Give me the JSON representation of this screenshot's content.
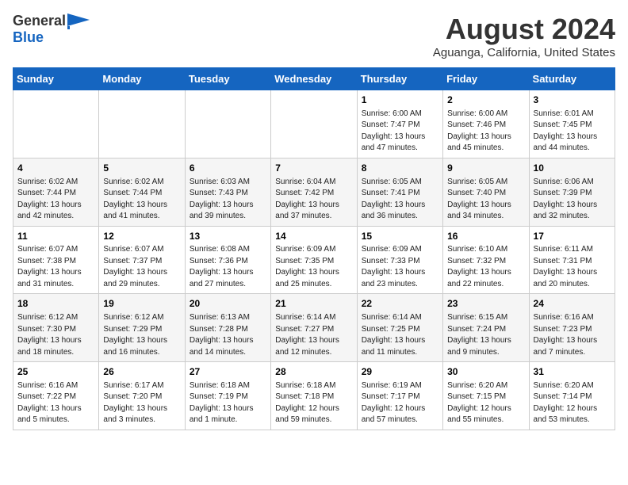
{
  "header": {
    "logo_general": "General",
    "logo_blue": "Blue",
    "month": "August 2024",
    "location": "Aguanga, California, United States"
  },
  "weekdays": [
    "Sunday",
    "Monday",
    "Tuesday",
    "Wednesday",
    "Thursday",
    "Friday",
    "Saturday"
  ],
  "weeks": [
    [
      {
        "day": "",
        "info": ""
      },
      {
        "day": "",
        "info": ""
      },
      {
        "day": "",
        "info": ""
      },
      {
        "day": "",
        "info": ""
      },
      {
        "day": "1",
        "info": "Sunrise: 6:00 AM\nSunset: 7:47 PM\nDaylight: 13 hours\nand 47 minutes."
      },
      {
        "day": "2",
        "info": "Sunrise: 6:00 AM\nSunset: 7:46 PM\nDaylight: 13 hours\nand 45 minutes."
      },
      {
        "day": "3",
        "info": "Sunrise: 6:01 AM\nSunset: 7:45 PM\nDaylight: 13 hours\nand 44 minutes."
      }
    ],
    [
      {
        "day": "4",
        "info": "Sunrise: 6:02 AM\nSunset: 7:44 PM\nDaylight: 13 hours\nand 42 minutes."
      },
      {
        "day": "5",
        "info": "Sunrise: 6:02 AM\nSunset: 7:44 PM\nDaylight: 13 hours\nand 41 minutes."
      },
      {
        "day": "6",
        "info": "Sunrise: 6:03 AM\nSunset: 7:43 PM\nDaylight: 13 hours\nand 39 minutes."
      },
      {
        "day": "7",
        "info": "Sunrise: 6:04 AM\nSunset: 7:42 PM\nDaylight: 13 hours\nand 37 minutes."
      },
      {
        "day": "8",
        "info": "Sunrise: 6:05 AM\nSunset: 7:41 PM\nDaylight: 13 hours\nand 36 minutes."
      },
      {
        "day": "9",
        "info": "Sunrise: 6:05 AM\nSunset: 7:40 PM\nDaylight: 13 hours\nand 34 minutes."
      },
      {
        "day": "10",
        "info": "Sunrise: 6:06 AM\nSunset: 7:39 PM\nDaylight: 13 hours\nand 32 minutes."
      }
    ],
    [
      {
        "day": "11",
        "info": "Sunrise: 6:07 AM\nSunset: 7:38 PM\nDaylight: 13 hours\nand 31 minutes."
      },
      {
        "day": "12",
        "info": "Sunrise: 6:07 AM\nSunset: 7:37 PM\nDaylight: 13 hours\nand 29 minutes."
      },
      {
        "day": "13",
        "info": "Sunrise: 6:08 AM\nSunset: 7:36 PM\nDaylight: 13 hours\nand 27 minutes."
      },
      {
        "day": "14",
        "info": "Sunrise: 6:09 AM\nSunset: 7:35 PM\nDaylight: 13 hours\nand 25 minutes."
      },
      {
        "day": "15",
        "info": "Sunrise: 6:09 AM\nSunset: 7:33 PM\nDaylight: 13 hours\nand 23 minutes."
      },
      {
        "day": "16",
        "info": "Sunrise: 6:10 AM\nSunset: 7:32 PM\nDaylight: 13 hours\nand 22 minutes."
      },
      {
        "day": "17",
        "info": "Sunrise: 6:11 AM\nSunset: 7:31 PM\nDaylight: 13 hours\nand 20 minutes."
      }
    ],
    [
      {
        "day": "18",
        "info": "Sunrise: 6:12 AM\nSunset: 7:30 PM\nDaylight: 13 hours\nand 18 minutes."
      },
      {
        "day": "19",
        "info": "Sunrise: 6:12 AM\nSunset: 7:29 PM\nDaylight: 13 hours\nand 16 minutes."
      },
      {
        "day": "20",
        "info": "Sunrise: 6:13 AM\nSunset: 7:28 PM\nDaylight: 13 hours\nand 14 minutes."
      },
      {
        "day": "21",
        "info": "Sunrise: 6:14 AM\nSunset: 7:27 PM\nDaylight: 13 hours\nand 12 minutes."
      },
      {
        "day": "22",
        "info": "Sunrise: 6:14 AM\nSunset: 7:25 PM\nDaylight: 13 hours\nand 11 minutes."
      },
      {
        "day": "23",
        "info": "Sunrise: 6:15 AM\nSunset: 7:24 PM\nDaylight: 13 hours\nand 9 minutes."
      },
      {
        "day": "24",
        "info": "Sunrise: 6:16 AM\nSunset: 7:23 PM\nDaylight: 13 hours\nand 7 minutes."
      }
    ],
    [
      {
        "day": "25",
        "info": "Sunrise: 6:16 AM\nSunset: 7:22 PM\nDaylight: 13 hours\nand 5 minutes."
      },
      {
        "day": "26",
        "info": "Sunrise: 6:17 AM\nSunset: 7:20 PM\nDaylight: 13 hours\nand 3 minutes."
      },
      {
        "day": "27",
        "info": "Sunrise: 6:18 AM\nSunset: 7:19 PM\nDaylight: 13 hours\nand 1 minute."
      },
      {
        "day": "28",
        "info": "Sunrise: 6:18 AM\nSunset: 7:18 PM\nDaylight: 12 hours\nand 59 minutes."
      },
      {
        "day": "29",
        "info": "Sunrise: 6:19 AM\nSunset: 7:17 PM\nDaylight: 12 hours\nand 57 minutes."
      },
      {
        "day": "30",
        "info": "Sunrise: 6:20 AM\nSunset: 7:15 PM\nDaylight: 12 hours\nand 55 minutes."
      },
      {
        "day": "31",
        "info": "Sunrise: 6:20 AM\nSunset: 7:14 PM\nDaylight: 12 hours\nand 53 minutes."
      }
    ]
  ]
}
